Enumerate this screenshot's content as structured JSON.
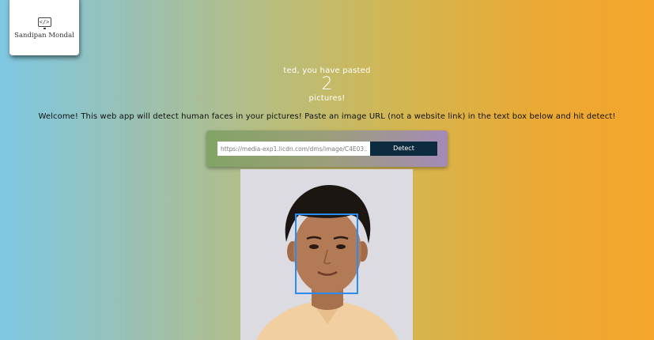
{
  "brand": {
    "name": "Sandipan Mondal",
    "icon": "code-icon",
    "icon_glyph": "</>"
  },
  "rank": {
    "line1": "ted, you have pasted",
    "count": "2",
    "line2": "pictures!"
  },
  "welcome": "Welcome! This web app will detect human faces in your pictures! Paste an image URL (not a website link) in the text box below and hit detect!",
  "form": {
    "url_value": "https://media-exp1.licdn.com/dms/image/C4E03...",
    "detect_label": "Detect"
  },
  "colors": {
    "face_box": "#2a8cf0",
    "button": "#0d2b3e"
  }
}
